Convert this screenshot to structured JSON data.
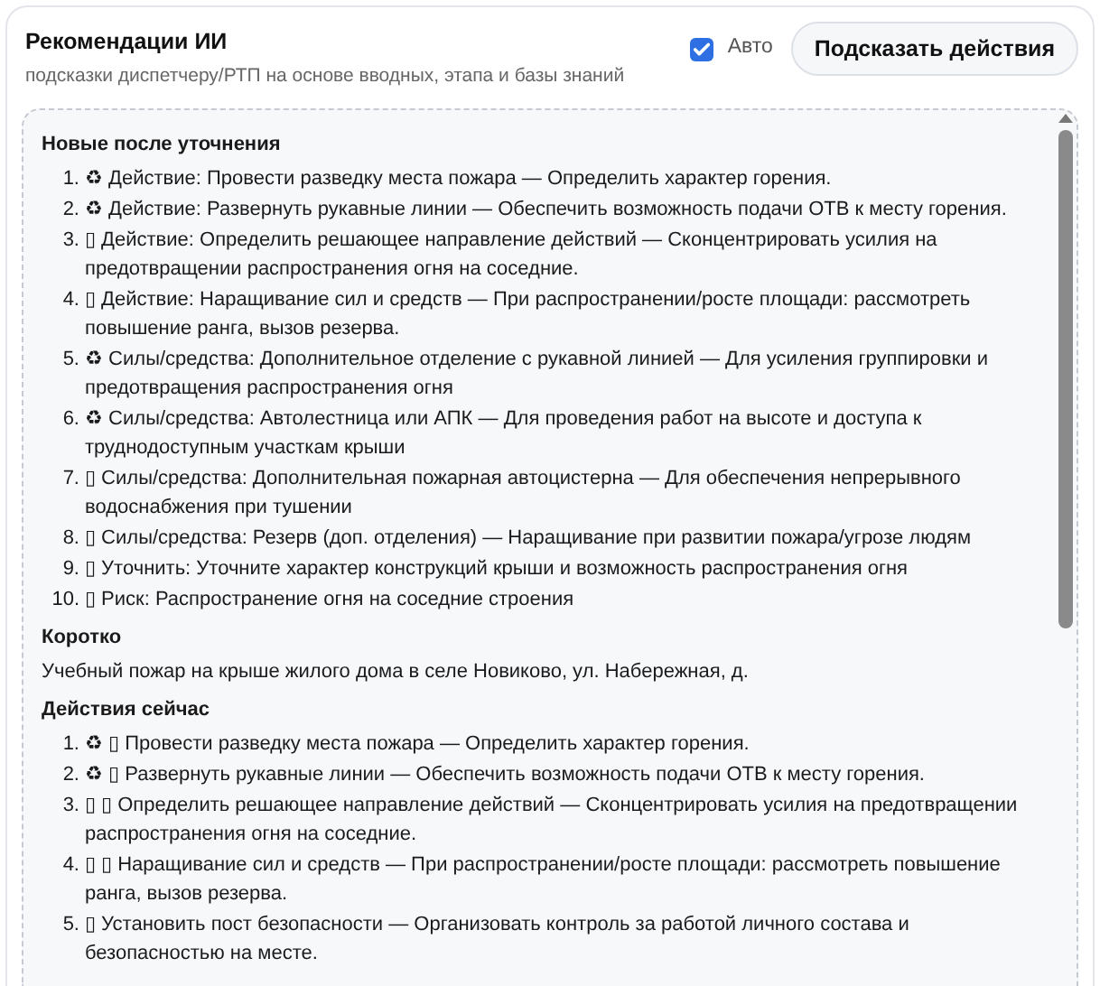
{
  "header": {
    "title": "Рекомендации ИИ",
    "subtitle": "подсказки диспетчеру/РТП на основе вводных, этапа и базы знаний",
    "auto": {
      "label": "Авто",
      "checked": true
    },
    "button": "Подсказать действия"
  },
  "sections": [
    {
      "kind": "list",
      "title": "Новые после уточнения",
      "items": [
        {
          "number": "1.",
          "text": "♻ Действие: Провести разведку места пожара — Определить характер горения."
        },
        {
          "number": "2.",
          "text": "♻ Действие: Развернуть рукавные линии — Обеспечить возможность подачи ОТВ к месту горения."
        },
        {
          "number": "3.",
          "text": "▯ Действие: Определить решающее направление действий — Сконцентрировать усилия на предотвращении распространения огня на соседние."
        },
        {
          "number": "4.",
          "text": "▯ Действие: Наращивание сил и средств — При распространении/росте площади: рассмотреть повышение ранга, вызов резерва."
        },
        {
          "number": "5.",
          "text": "♻ Силы/средства: Дополнительное отделение с рукавной линией — Для усиления группировки и предотвращения распространения огня"
        },
        {
          "number": "6.",
          "text": "♻ Силы/средства: Автолестница или АПК — Для проведения работ на высоте и доступа к труднодоступным участкам крыши"
        },
        {
          "number": "7.",
          "text": "▯ Силы/средства: Дополнительная пожарная автоцистерна — Для обеспечения непрерывного водоснабжения при тушении"
        },
        {
          "number": "8.",
          "text": "▯ Силы/средства: Резерв (доп. отделения) — Наращивание при развитии пожара/угрозе людям"
        },
        {
          "number": "9.",
          "text": "▯ Уточнить: Уточните характер конструкций крыши и возможность распространения огня"
        },
        {
          "number": "10.",
          "text": "▯ Риск: Распространение огня на соседние строения"
        }
      ]
    },
    {
      "kind": "text",
      "title": "Коротко",
      "text": "Учебный пожар на крыше жилого дома в селе Новиково, ул. Набережная, д."
    },
    {
      "kind": "list",
      "title": "Действия сейчас",
      "items": [
        {
          "number": "1.",
          "text": "♻ ▯ Провести разведку места пожара — Определить характер горения."
        },
        {
          "number": "2.",
          "text": "♻ ▯ Развернуть рукавные линии — Обеспечить возможность подачи ОТВ к месту горения."
        },
        {
          "number": "3.",
          "text": "▯ ▯ Определить решающее направление действий — Сконцентрировать усилия на предотвращении распространения огня на соседние."
        },
        {
          "number": "4.",
          "text": "▯ ▯ Наращивание сил и средств — При распространении/росте площади: рассмотреть повышение ранга, вызов резерва."
        },
        {
          "number": "5.",
          "text": "▯ Установить пост безопасности — Организовать контроль за работой личного состава и безопасностью на месте."
        }
      ]
    }
  ]
}
